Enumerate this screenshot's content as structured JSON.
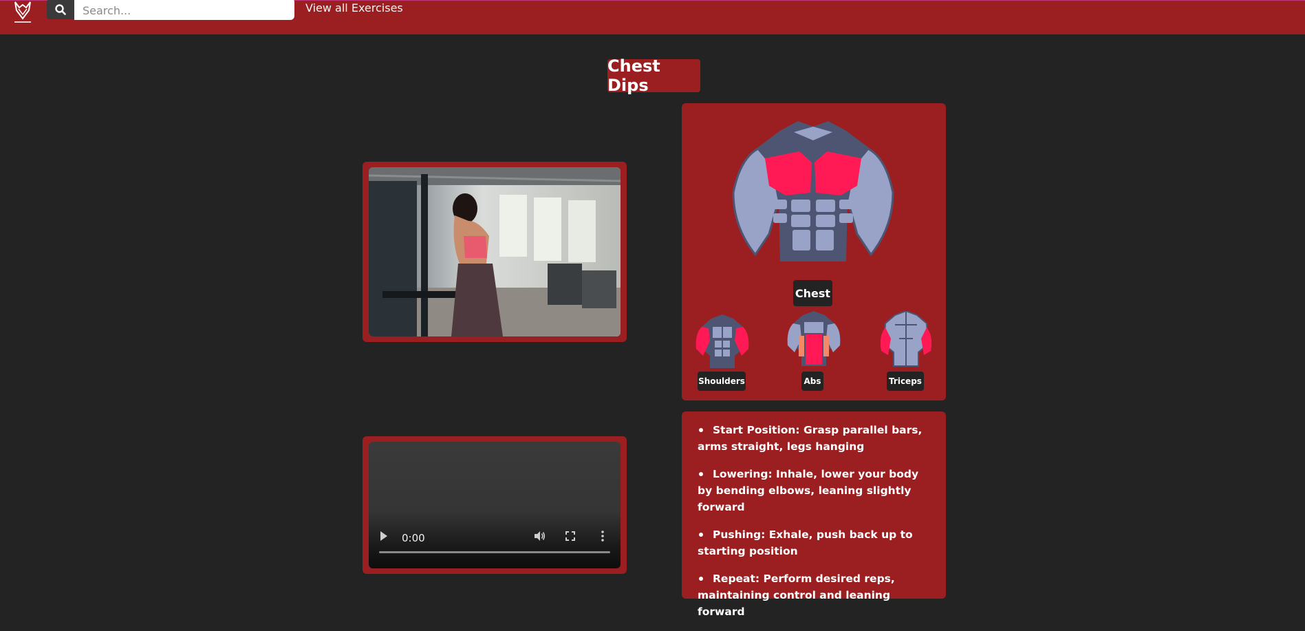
{
  "header": {
    "search": {
      "placeholder": "Search..."
    },
    "view_all_label": "View all Exercises"
  },
  "exercise": {
    "title": "Chest Dips",
    "primary_muscle": "Chest",
    "secondary_muscles": [
      "Shoulders",
      "Abs",
      "Triceps"
    ],
    "video": {
      "time": "0:00"
    },
    "steps": [
      "Start Position: Grasp parallel bars, arms straight, legs hanging",
      "Lowering: Inhale, lower your body by bending elbows, leaning slightly forward",
      "Pushing: Exhale, push back up to starting position",
      "Repeat: Perform desired reps, maintaining control and leaning forward"
    ]
  },
  "colors": {
    "brand_red": "#9b1f20",
    "background": "#232323",
    "muscle_highlight": "#ff1a55",
    "muscle_base": "#98a3c7"
  },
  "icons": [
    "logo-icon",
    "search-icon",
    "play-icon",
    "volume-icon",
    "fullscreen-icon",
    "more-options-icon"
  ]
}
